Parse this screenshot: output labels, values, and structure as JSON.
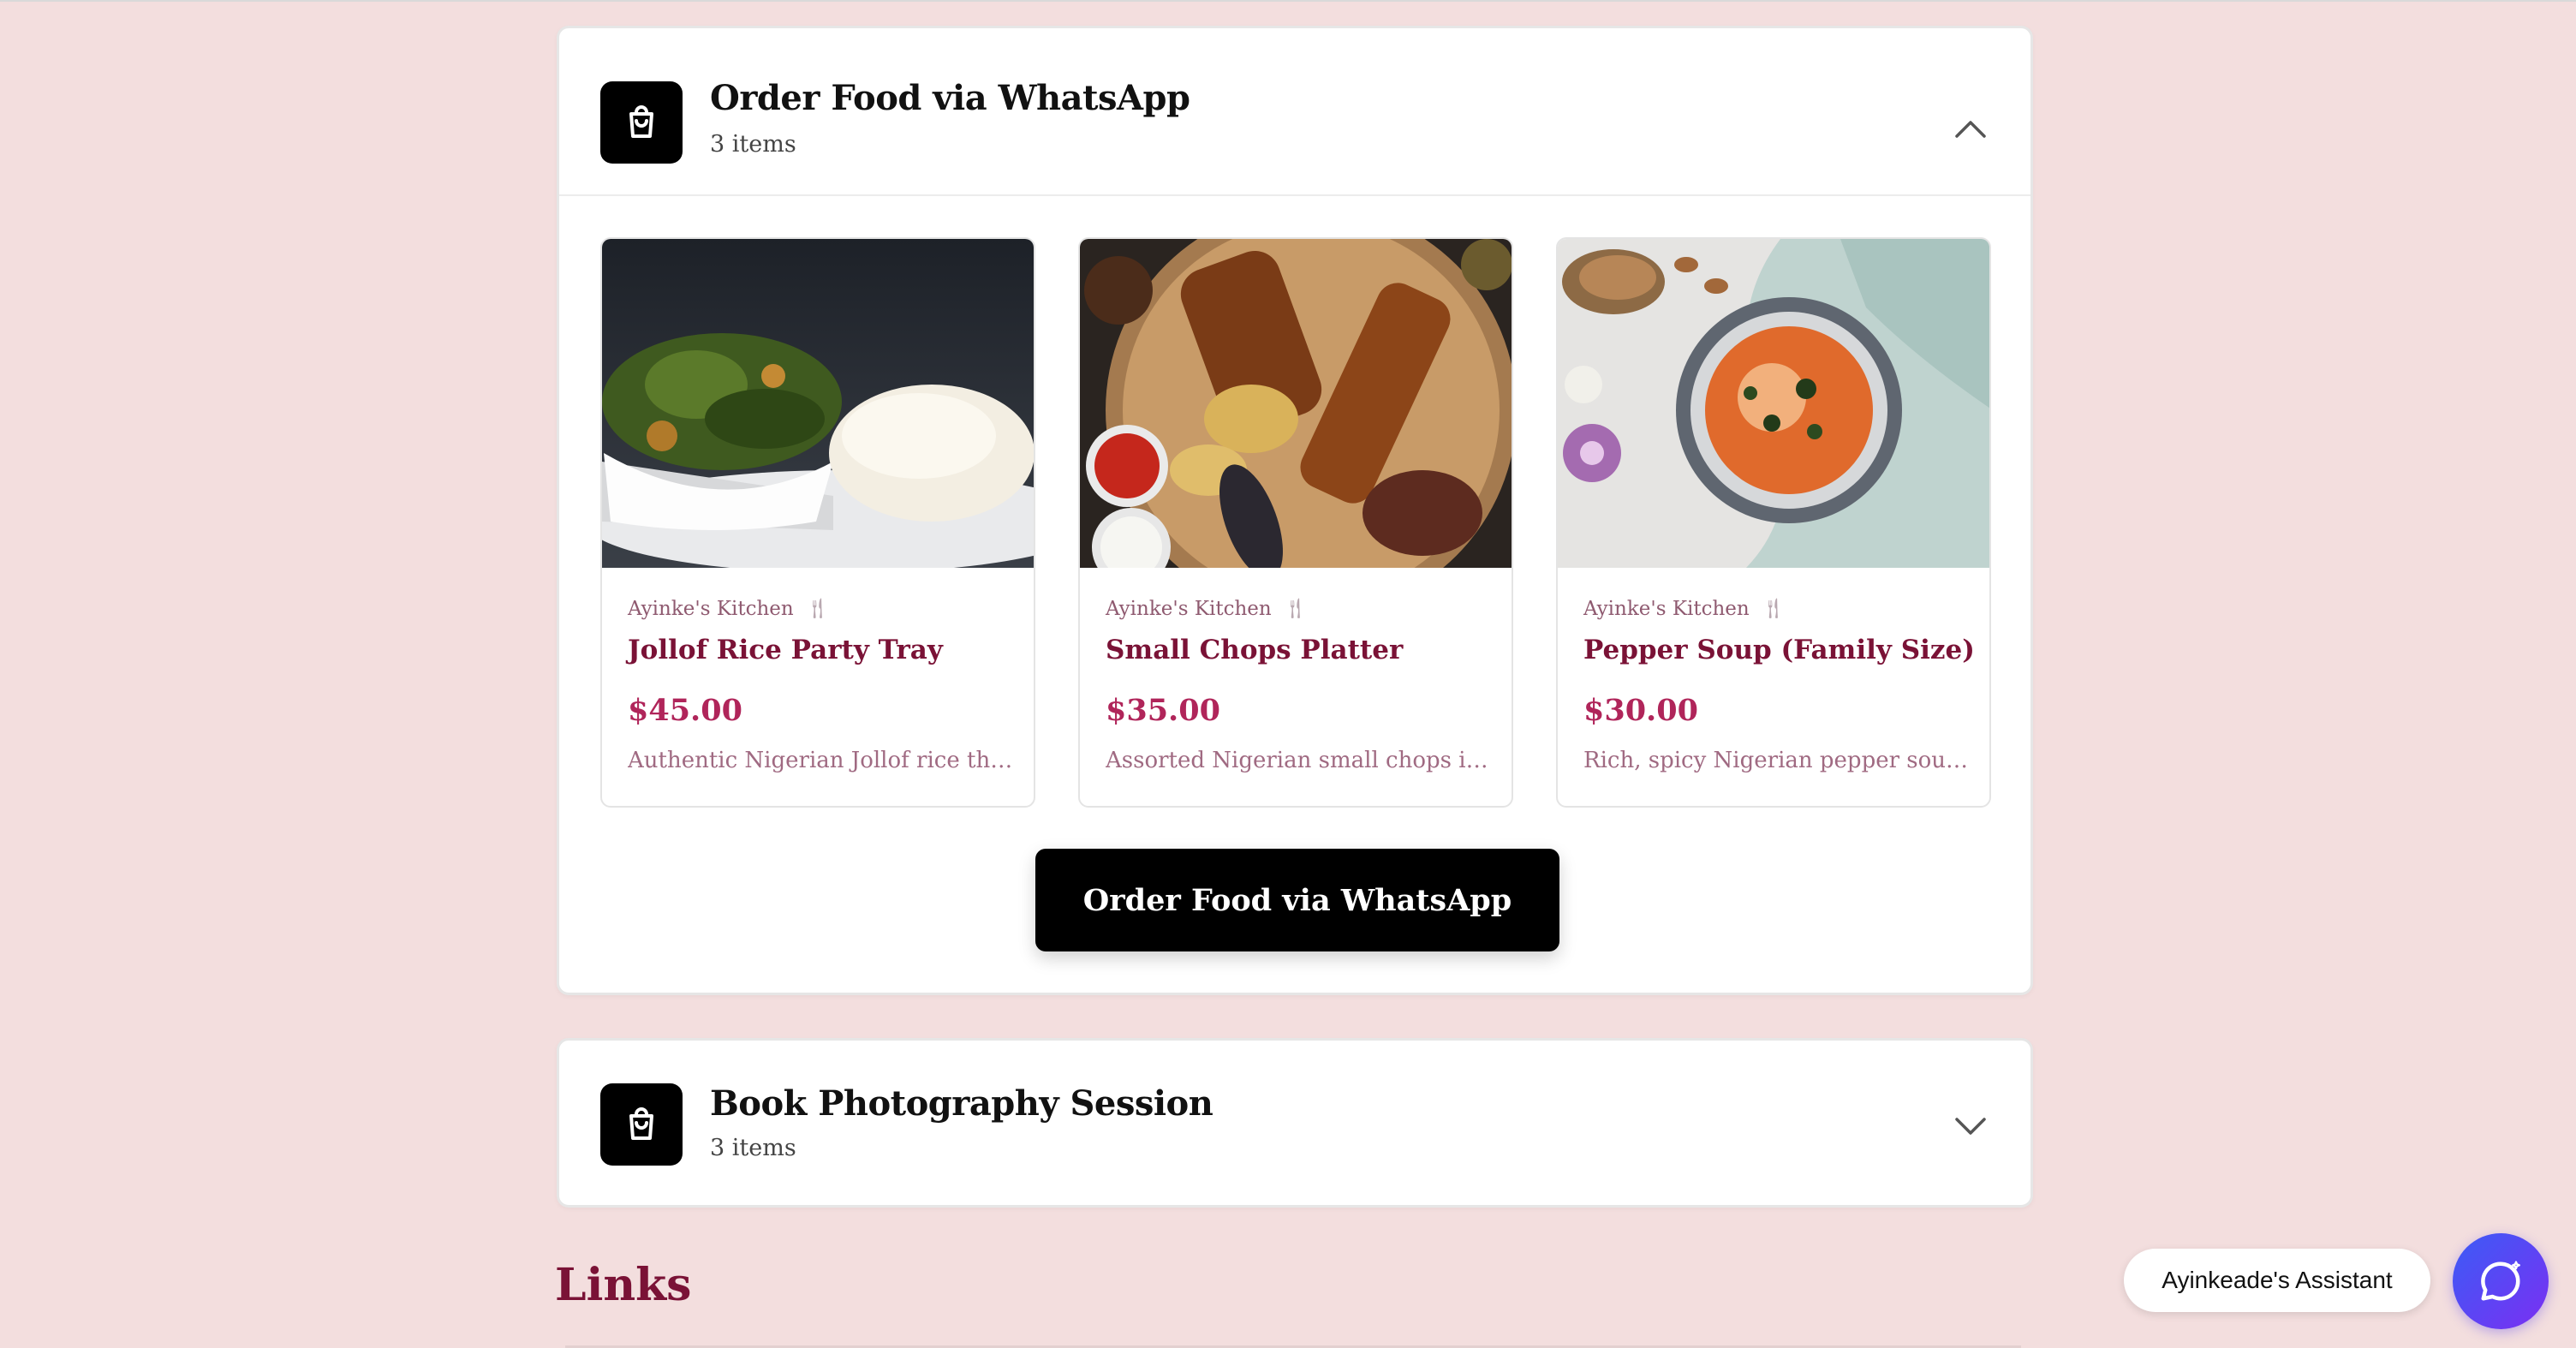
{
  "sections": [
    {
      "title": "Order Food via WhatsApp",
      "subtitle": "3 items",
      "expanded": true,
      "products": [
        {
          "shop": "Ayinke's Kitchen",
          "name": "Jollof Rice Party Tray",
          "price": "$45.00",
          "description": "Authentic Nigerian Jollof rice tha..."
        },
        {
          "shop": "Ayinke's Kitchen",
          "name": "Small Chops Platter",
          "price": "$35.00",
          "description": "Assorted Nigerian small chops in..."
        },
        {
          "shop": "Ayinke's Kitchen",
          "name": "Pepper Soup (Family Size)",
          "price": "$30.00",
          "description": "Rich, spicy Nigerian pepper soup..."
        }
      ],
      "cta_label": "Order Food via WhatsApp"
    },
    {
      "title": "Book Photography Session",
      "subtitle": "3 items",
      "expanded": false
    }
  ],
  "links_heading": "Links",
  "assistant": {
    "label": "Ayinkeade's Assistant"
  },
  "icons": {
    "section_icon": "shopping-bag-icon",
    "collapse": "chevron-up-icon",
    "expand": "chevron-down-icon",
    "shop_badge": "utensils-icon",
    "chat": "chat-bubble-icon"
  },
  "colors": {
    "accent": "#7a1236",
    "price": "#b0255a",
    "background": "#fbf1f1",
    "assistant_gradient_start": "#3b5cf6",
    "assistant_gradient_end": "#7b2ff2"
  }
}
